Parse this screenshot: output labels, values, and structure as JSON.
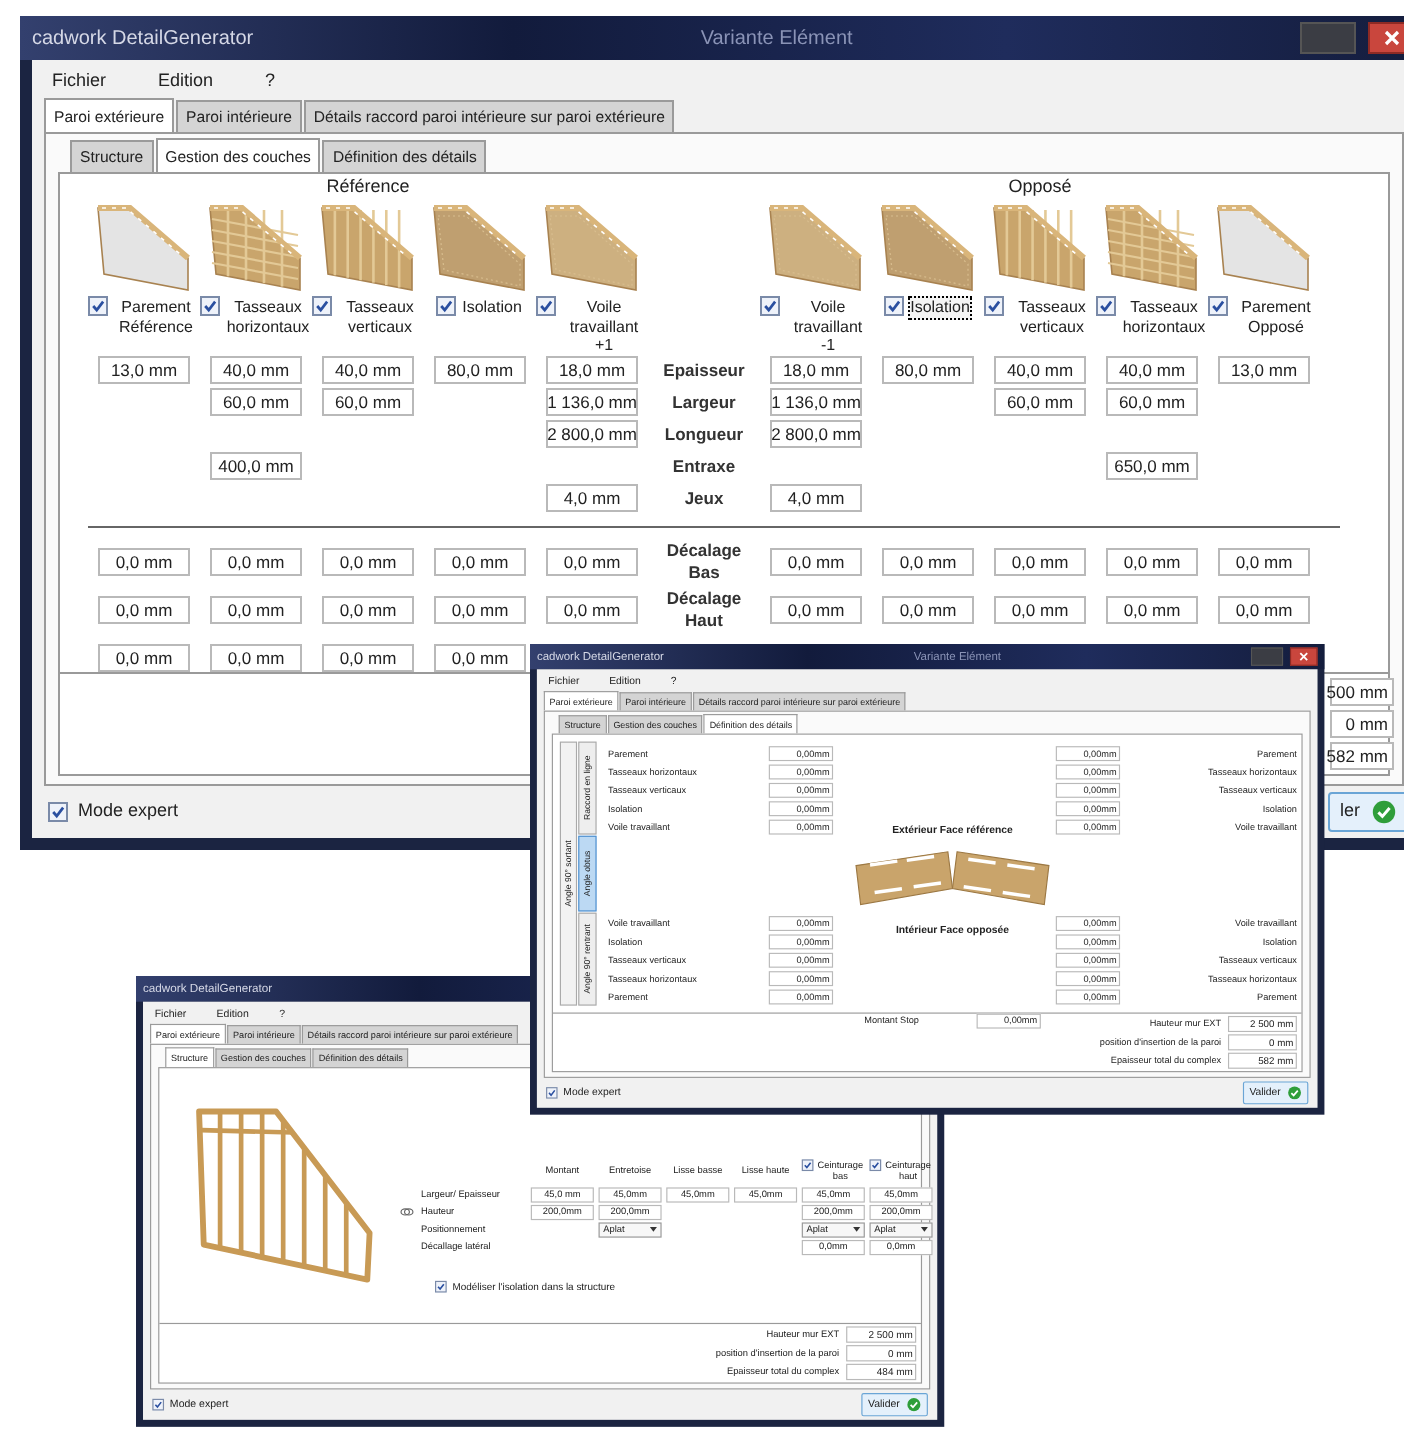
{
  "windows": [
    {
      "kind": "layers",
      "title": "cadwork DetailGenerator",
      "subtitle": "Variante Elément",
      "menu": [
        "Fichier",
        "Edition",
        "?"
      ],
      "tabs": [
        {
          "label": "Paroi extérieure",
          "selected": true
        },
        {
          "label": "Paroi intérieure",
          "selected": false
        },
        {
          "label": "Détails raccord paroi intérieure sur paroi extérieure",
          "selected": false
        }
      ],
      "subtabs": [
        {
          "label": "Structure",
          "selected": false
        },
        {
          "label": "Gestion des couches",
          "selected": true
        },
        {
          "label": "Définition des détails",
          "selected": false
        }
      ],
      "groups": [
        "Référence",
        "Opposé"
      ],
      "row_labels": [
        "Epaisseur",
        "Largeur",
        "Longueur",
        "Entraxe",
        "Jeux"
      ],
      "offset_labels": [
        "Décalage Bas",
        "Décalage Haut"
      ],
      "layers": [
        {
          "kind": "facing",
          "label": "Parement Référence",
          "checked": true,
          "focused": false,
          "values": [
            {
              "kind": "thickness",
              "text": "13,0 mm"
            }
          ],
          "offsets": [
            "0,0 mm",
            "0,0 mm",
            "0,0 mm"
          ]
        },
        {
          "kind": "horizontal",
          "label": "Tasseaux horizontaux",
          "checked": true,
          "focused": false,
          "values": [
            {
              "kind": "thickness",
              "text": "40,0 mm"
            },
            {
              "kind": "width",
              "text": "60,0 mm"
            },
            {
              "kind": "spacing",
              "text": "400,0 mm"
            }
          ],
          "offsets": [
            "0,0 mm",
            "0,0 mm",
            "0,0 mm"
          ]
        },
        {
          "kind": "vertical",
          "label": "Tasseaux verticaux",
          "checked": true,
          "focused": false,
          "values": [
            {
              "kind": "thickness",
              "text": "40,0 mm"
            },
            {
              "kind": "width",
              "text": "60,0 mm"
            }
          ],
          "offsets": [
            "0,0 mm",
            "0,0 mm",
            "0,0 mm"
          ]
        },
        {
          "kind": "insulation",
          "label": "Isolation",
          "checked": true,
          "focused": false,
          "values": [
            {
              "kind": "thickness",
              "text": "80,0 mm"
            }
          ],
          "offsets": [
            "0,0 mm",
            "0,0 mm",
            "0,0 mm"
          ]
        },
        {
          "kind": "sheathing",
          "label": "Voile travaillant +1",
          "checked": true,
          "focused": false,
          "values": [
            {
              "kind": "thickness",
              "text": "18,0 mm"
            },
            {
              "kind": "width",
              "text": "1 136,0 mm"
            },
            {
              "kind": "length",
              "text": "2 800,0 mm"
            },
            {
              "kind": "gap",
              "text": "4,0 mm"
            }
          ],
          "offsets": [
            "0,0 mm",
            "0,0 mm"
          ]
        },
        {
          "kind": "sheathing",
          "label": "Voile travaillant -1",
          "checked": true,
          "focused": false,
          "values": [
            {
              "kind": "thickness",
              "text": "18,0 mm"
            },
            {
              "kind": "width",
              "text": "1 136,0 mm"
            },
            {
              "kind": "length",
              "text": "2 800,0 mm"
            },
            {
              "kind": "gap",
              "text": "4,0 mm"
            }
          ],
          "offsets": [
            "0,0 mm",
            "0,0 mm"
          ]
        },
        {
          "kind": "insulation",
          "label": "Isolation",
          "checked": true,
          "focused": true,
          "values": [
            {
              "kind": "thickness",
              "text": "80,0 mm"
            }
          ],
          "offsets": [
            "0,0 mm",
            "0,0 mm"
          ]
        },
        {
          "kind": "vertical",
          "label": "Tasseaux verticaux",
          "checked": true,
          "focused": false,
          "values": [
            {
              "kind": "thickness",
              "text": "40,0 mm"
            },
            {
              "kind": "width",
              "text": "60,0 mm"
            }
          ],
          "offsets": [
            "0,0 mm",
            "0,0 mm"
          ]
        },
        {
          "kind": "horizontal",
          "label": "Tasseaux horizontaux",
          "checked": true,
          "focused": false,
          "values": [
            {
              "kind": "thickness",
              "text": "40,0 mm"
            },
            {
              "kind": "width",
              "text": "60,0 mm"
            },
            {
              "kind": "spacing",
              "text": "650,0 mm"
            }
          ],
          "offsets": [
            "0,0 mm",
            "0,0 mm"
          ]
        },
        {
          "kind": "facing",
          "label": "Parement Opposé",
          "checked": true,
          "focused": false,
          "values": [
            {
              "kind": "thickness",
              "text": "13,0 mm"
            }
          ],
          "offsets": [
            "0,0 mm",
            "0,0 mm"
          ]
        }
      ],
      "footer": [
        {
          "value": "500 mm"
        },
        {
          "value": "0 mm"
        },
        {
          "value": "582 mm"
        }
      ],
      "expert": {
        "label": "Mode expert",
        "checked": true
      },
      "submit": {
        "label": "ler"
      }
    },
    {
      "kind": "details",
      "title": "cadwork DetailGenerator",
      "subtitle": "Variante Elément",
      "menu": [
        "Fichier",
        "Edition",
        "?"
      ],
      "tabs": [
        {
          "label": "Paroi extérieure",
          "selected": true
        },
        {
          "label": "Paroi intérieure",
          "selected": false
        },
        {
          "label": "Détails raccord paroi intérieure sur paroi extérieure",
          "selected": false
        }
      ],
      "subtabs": [
        {
          "label": "Structure",
          "selected": false
        },
        {
          "label": "Gestion des couches",
          "selected": false
        },
        {
          "label": "Définition des détails",
          "selected": true
        }
      ],
      "side_group": "Angle 90° sortant",
      "side_tabs": [
        {
          "label": "Raccord en ligne",
          "selected": false
        },
        {
          "label": "Angle obtus",
          "selected": true
        },
        {
          "label": "Angle 90° rentrant",
          "selected": false
        }
      ],
      "top_left": [
        {
          "label": "Parement",
          "value": "0,00mm"
        },
        {
          "label": "Tasseaux horizontaux",
          "value": "0,00mm"
        },
        {
          "label": "Tasseaux verticaux",
          "value": "0,00mm"
        },
        {
          "label": "Isolation",
          "value": "0,00mm"
        },
        {
          "label": "Voile travaillant",
          "value": "0,00mm"
        }
      ],
      "top_right": [
        {
          "label": "Parement",
          "value": "0,00mm"
        },
        {
          "label": "Tasseaux horizontaux",
          "value": "0,00mm"
        },
        {
          "label": "Tasseaux verticaux",
          "value": "0,00mm"
        },
        {
          "label": "Isolation",
          "value": "0,00mm"
        },
        {
          "label": "Voile travaillant",
          "value": "0,00mm"
        }
      ],
      "top_caption": "Extérieur Face référence",
      "bottom_caption": "Intérieur Face opposée",
      "bottom_left": [
        {
          "label": "Voile travaillant",
          "value": "0,00mm"
        },
        {
          "label": "Isolation",
          "value": "0,00mm"
        },
        {
          "label": "Tasseaux verticaux",
          "value": "0,00mm"
        },
        {
          "label": "Tasseaux horizontaux",
          "value": "0,00mm"
        },
        {
          "label": "Parement",
          "value": "0,00mm"
        }
      ],
      "bottom_right": [
        {
          "label": "Voile travaillant",
          "value": "0,00mm"
        },
        {
          "label": "Isolation",
          "value": "0,00mm"
        },
        {
          "label": "Tasseaux verticaux",
          "value": "0,00mm"
        },
        {
          "label": "Tasseaux horizontaux",
          "value": "0,00mm"
        },
        {
          "label": "Parement",
          "value": "0,00mm"
        }
      ],
      "stop": {
        "label": "Montant Stop",
        "value": "0,00mm"
      },
      "footer": [
        {
          "label": "Hauteur mur EXT",
          "value": "2 500 mm"
        },
        {
          "label": "position d'insertion de la paroi",
          "value": "0 mm"
        },
        {
          "label": "Epaisseur total du complex",
          "value": "582 mm"
        }
      ],
      "expert": {
        "label": "Mode expert",
        "checked": true
      },
      "submit": {
        "label": "Valider"
      }
    },
    {
      "kind": "structure",
      "title": "cadwork DetailGenerator",
      "menu": [
        "Fichier",
        "Edition",
        "?"
      ],
      "tabs": [
        {
          "label": "Paroi extérieure",
          "selected": true
        },
        {
          "label": "Paroi intérieure",
          "selected": false
        },
        {
          "label": "Détails raccord paroi intérieure sur paroi extérieure",
          "selected": false
        }
      ],
      "subtabs": [
        {
          "label": "Structure",
          "selected": true
        },
        {
          "label": "Gestion des couches",
          "selected": false
        },
        {
          "label": "Définition des détails",
          "selected": false
        }
      ],
      "columns": [
        {
          "kind": "plain",
          "label": "Montant"
        },
        {
          "kind": "plain",
          "label": "Entretoise"
        },
        {
          "kind": "plain",
          "label": "Lisse basse"
        },
        {
          "kind": "plain",
          "label": "Lisse haute"
        },
        {
          "kind": "check",
          "label": "Ceinturage bas",
          "checked": true
        },
        {
          "kind": "check",
          "label": "Ceinturage haut",
          "checked": true
        }
      ],
      "rows": [
        {
          "kind": "field",
          "label": "Largeur/ Epaisseur",
          "cells": [
            "45,0 mm",
            "45,0mm",
            "45,0mm",
            "45,0mm",
            "45,0mm",
            "45,0mm"
          ]
        },
        {
          "kind": "field",
          "label": "Hauteur",
          "cells": [
            "200,0mm",
            "200,0mm",
            "",
            "",
            "200,0mm",
            "200,0mm"
          ]
        },
        {
          "kind": "select",
          "label": "Positionnement",
          "cells": [
            "",
            "Aplat",
            "",
            "",
            "Aplat",
            "Aplat"
          ]
        },
        {
          "kind": "field",
          "label": "Décallage latéral",
          "cells": [
            "",
            "",
            "",
            "",
            "0,0mm",
            "0,0mm"
          ]
        }
      ],
      "insulation": {
        "label": "Modéliser l'isolation dans la structure",
        "checked": true
      },
      "footer": [
        {
          "label": "Hauteur mur EXT",
          "value": "2 500 mm"
        },
        {
          "label": "position d'insertion de la paroi",
          "value": "0 mm"
        },
        {
          "label": "Epaisseur total du complex",
          "value": "484 mm"
        }
      ],
      "expert": {
        "label": "Mode expert",
        "checked": true
      },
      "submit": {
        "label": "Valider"
      }
    }
  ]
}
